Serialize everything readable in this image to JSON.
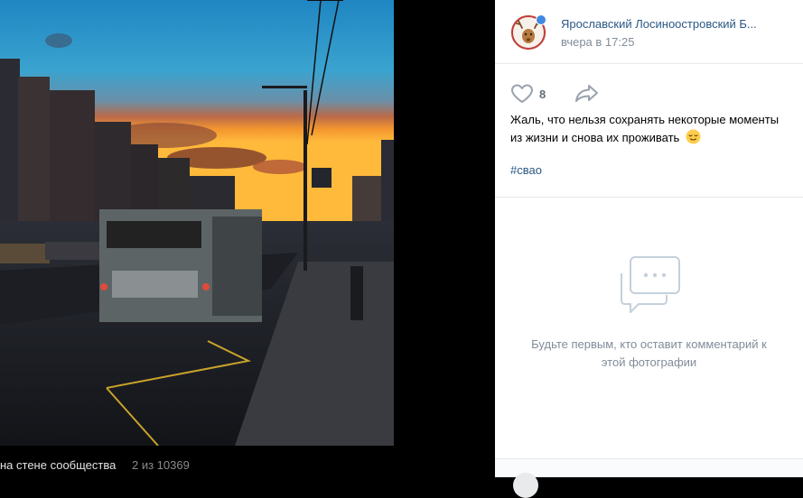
{
  "photo": {
    "album_label": "на стене сообщества",
    "counter": "2 из 10369"
  },
  "author": {
    "name": "Ярославский Лосиноостровский Б...",
    "date": "вчера в 17:25",
    "verified": true
  },
  "actions": {
    "likes_count": "8",
    "like_icon": "heart-icon",
    "share_icon": "share-arrow-icon"
  },
  "post": {
    "text": "Жаль, что нельзя сохранять некоторые моменты из жизни и снова их проживать",
    "emoji": "relieved-face-emoji",
    "hashtag": "#свао"
  },
  "comments": {
    "empty_text": "Будьте первым, кто оставит комментарий к этой фотографии",
    "empty_icon": "chat-bubble-icon"
  },
  "colors": {
    "link": "#2a5885",
    "muted": "#818c99",
    "accent": "#3f8ae0"
  }
}
